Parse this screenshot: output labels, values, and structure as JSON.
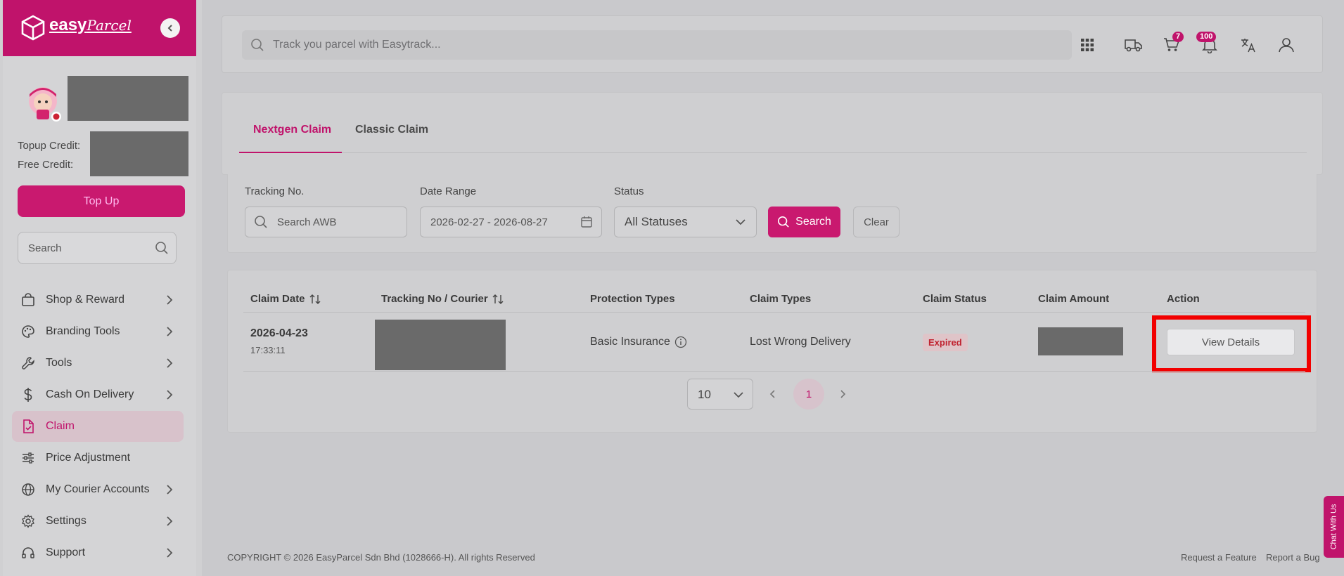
{
  "brand": {
    "name_bold": "easy",
    "name_script": "Parcel"
  },
  "sidebar": {
    "topup_credit_label": "Topup Credit:",
    "free_credit_label": "Free Credit:",
    "topup_button": "Top Up",
    "search_placeholder": "Search",
    "items": [
      {
        "label": "Shop & Reward",
        "icon": "shopping-bag-icon",
        "has_submenu": true
      },
      {
        "label": "Branding Tools",
        "icon": "palette-icon",
        "has_submenu": true
      },
      {
        "label": "Tools",
        "icon": "wrench-icon",
        "has_submenu": true
      },
      {
        "label": "Cash On Delivery",
        "icon": "dollar-icon",
        "has_submenu": true
      },
      {
        "label": "Claim",
        "icon": "claim-document-icon",
        "has_submenu": false,
        "active": true
      },
      {
        "label": "Price Adjustment",
        "icon": "sliders-icon",
        "has_submenu": false
      },
      {
        "label": "My Courier Accounts",
        "icon": "globe-icon",
        "has_submenu": true
      },
      {
        "label": "Settings",
        "icon": "gear-icon",
        "has_submenu": true
      },
      {
        "label": "Support",
        "icon": "headset-icon",
        "has_submenu": true
      }
    ]
  },
  "topbar": {
    "search_placeholder": "Track you parcel with Easytrack...",
    "cart_badge": "7",
    "notification_badge": "100"
  },
  "tabs": [
    {
      "label": "Nextgen Claim",
      "active": true
    },
    {
      "label": "Classic Claim",
      "active": false
    }
  ],
  "filters": {
    "tracking_label": "Tracking No.",
    "tracking_placeholder": "Search AWB",
    "date_label": "Date Range",
    "date_value": "2026-02-27 - 2026-08-27",
    "status_label": "Status",
    "status_value": "All Statuses",
    "search_button": "Search",
    "clear_button": "Clear"
  },
  "table": {
    "headers": [
      "Claim Date",
      "Tracking No / Courier",
      "Protection Types",
      "Claim Types",
      "Claim Status",
      "Claim Amount",
      "Action"
    ],
    "rows": [
      {
        "claim_date": "2026-04-23",
        "claim_time": "17:33:11",
        "protection_type": "Basic Insurance",
        "claim_type": "Lost Wrong Delivery",
        "claim_status": "Expired",
        "action": "View Details"
      }
    ],
    "page_size": "10",
    "current_page": "1"
  },
  "footer": {
    "copyright": "COPYRIGHT © 2026 EasyParcel Sdn Bhd (1028666-H). All rights Reserved",
    "request_feature": "Request a Feature",
    "report_bug": "Report a Bug",
    "chat": "Chat With Us"
  },
  "colors": {
    "brand": "#c0136b",
    "highlight": "#f20000",
    "expired_text": "#c0222f"
  }
}
